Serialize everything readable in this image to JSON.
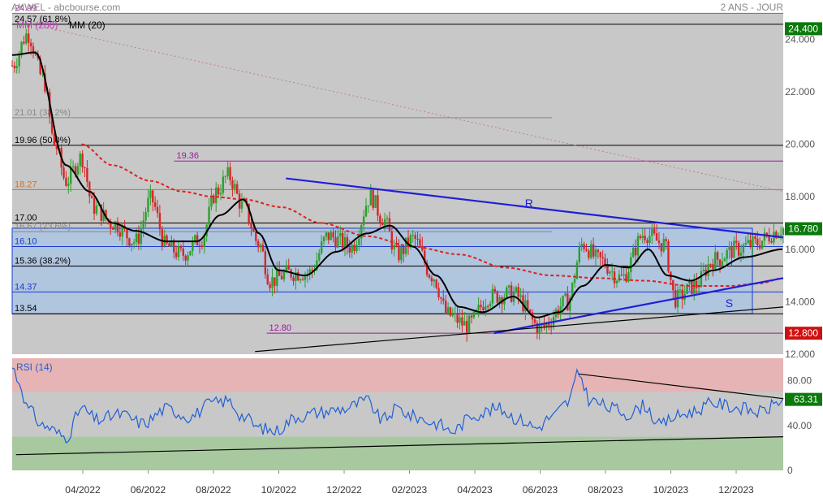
{
  "header": {
    "source": "AKWEL - abcbourse.com",
    "period": "2 ANS - JOUR",
    "legend_ma200": "MM (200)",
    "legend_ma20": "MM (20)"
  },
  "colors": {
    "panel_bg": "#c8c8c8",
    "candle_up": "#2ca02c",
    "candle_down": "#d62728",
    "ma20": "#000000",
    "ma200": "#e02020",
    "trendline": "#1f1fd6",
    "rsi_line": "#1f5fd6",
    "band_fill": "#a8c4e6",
    "rsi_over": "#e6b4b4",
    "rsi_under": "#a8c8a0",
    "axis_label_bg": "#0a7a0a",
    "axis_label_red": "#d01010",
    "fib_line": "#9a1a9a"
  },
  "chart_data": [
    {
      "type": "candlestick",
      "title": "AKWEL",
      "xlabel": "",
      "ylabel": "",
      "ylim": [
        12.0,
        25.0
      ],
      "x_ticks": [
        "04/2022",
        "06/2022",
        "08/2022",
        "10/2022",
        "12/2022",
        "02/2023",
        "04/2023",
        "06/2023",
        "08/2023",
        "10/2023",
        "12/2023"
      ],
      "y_ticks": [
        "12.000",
        "14.000",
        "16.000",
        "18.000",
        "20.000",
        "22.000",
        "24.000"
      ],
      "last_price": "16.780",
      "axis_markers": [
        "24.400",
        "12.800"
      ],
      "price_anchors": [
        {
          "t": 0.0,
          "v": 23.0
        },
        {
          "t": 0.02,
          "v": 24.2
        },
        {
          "t": 0.04,
          "v": 22.5
        },
        {
          "t": 0.055,
          "v": 20.0
        },
        {
          "t": 0.07,
          "v": 18.6
        },
        {
          "t": 0.09,
          "v": 19.5
        },
        {
          "t": 0.105,
          "v": 17.6
        },
        {
          "t": 0.13,
          "v": 17.0
        },
        {
          "t": 0.16,
          "v": 16.3
        },
        {
          "t": 0.18,
          "v": 17.9
        },
        {
          "t": 0.2,
          "v": 16.1
        },
        {
          "t": 0.22,
          "v": 15.8
        },
        {
          "t": 0.245,
          "v": 16.4
        },
        {
          "t": 0.265,
          "v": 18.2
        },
        {
          "t": 0.28,
          "v": 18.8
        },
        {
          "t": 0.3,
          "v": 17.6
        },
        {
          "t": 0.32,
          "v": 16.2
        },
        {
          "t": 0.335,
          "v": 14.8
        },
        {
          "t": 0.36,
          "v": 15.1
        },
        {
          "t": 0.385,
          "v": 15.1
        },
        {
          "t": 0.41,
          "v": 16.5
        },
        {
          "t": 0.44,
          "v": 16.1
        },
        {
          "t": 0.465,
          "v": 18.0
        },
        {
          "t": 0.48,
          "v": 17.2
        },
        {
          "t": 0.5,
          "v": 15.8
        },
        {
          "t": 0.52,
          "v": 16.4
        },
        {
          "t": 0.545,
          "v": 15.0
        },
        {
          "t": 0.565,
          "v": 13.5
        },
        {
          "t": 0.59,
          "v": 13.1
        },
        {
          "t": 0.62,
          "v": 14.2
        },
        {
          "t": 0.65,
          "v": 14.3
        },
        {
          "t": 0.685,
          "v": 13.0
        },
        {
          "t": 0.72,
          "v": 14.0
        },
        {
          "t": 0.74,
          "v": 16.2
        },
        {
          "t": 0.76,
          "v": 15.6
        },
        {
          "t": 0.79,
          "v": 14.9
        },
        {
          "t": 0.82,
          "v": 16.6
        },
        {
          "t": 0.845,
          "v": 16.2
        },
        {
          "t": 0.86,
          "v": 14.1
        },
        {
          "t": 0.885,
          "v": 14.6
        },
        {
          "t": 0.91,
          "v": 15.6
        },
        {
          "t": 0.94,
          "v": 16.0
        },
        {
          "t": 0.96,
          "v": 16.2
        },
        {
          "t": 1.0,
          "v": 16.78
        }
      ],
      "ma20_anchors": [
        {
          "t": 0.0,
          "v": 23.4
        },
        {
          "t": 0.03,
          "v": 23.5
        },
        {
          "t": 0.07,
          "v": 19.2
        },
        {
          "t": 0.1,
          "v": 18.2
        },
        {
          "t": 0.13,
          "v": 17.0
        },
        {
          "t": 0.16,
          "v": 16.7
        },
        {
          "t": 0.2,
          "v": 16.3
        },
        {
          "t": 0.24,
          "v": 16.3
        },
        {
          "t": 0.27,
          "v": 17.3
        },
        {
          "t": 0.3,
          "v": 17.9
        },
        {
          "t": 0.32,
          "v": 16.6
        },
        {
          "t": 0.345,
          "v": 15.2
        },
        {
          "t": 0.38,
          "v": 15.0
        },
        {
          "t": 0.42,
          "v": 15.9
        },
        {
          "t": 0.46,
          "v": 16.6
        },
        {
          "t": 0.49,
          "v": 16.9
        },
        {
          "t": 0.52,
          "v": 16.1
        },
        {
          "t": 0.55,
          "v": 15.0
        },
        {
          "t": 0.58,
          "v": 13.8
        },
        {
          "t": 0.61,
          "v": 13.6
        },
        {
          "t": 0.65,
          "v": 14.2
        },
        {
          "t": 0.68,
          "v": 13.4
        },
        {
          "t": 0.71,
          "v": 13.6
        },
        {
          "t": 0.74,
          "v": 14.6
        },
        {
          "t": 0.77,
          "v": 15.4
        },
        {
          "t": 0.8,
          "v": 15.3
        },
        {
          "t": 0.825,
          "v": 16.0
        },
        {
          "t": 0.85,
          "v": 15.0
        },
        {
          "t": 0.88,
          "v": 14.8
        },
        {
          "t": 0.91,
          "v": 15.2
        },
        {
          "t": 0.95,
          "v": 15.7
        },
        {
          "t": 1.0,
          "v": 16.0
        }
      ],
      "ma200_anchors": [
        {
          "t": 0.09,
          "v": 20.0
        },
        {
          "t": 0.13,
          "v": 19.2
        },
        {
          "t": 0.18,
          "v": 18.6
        },
        {
          "t": 0.22,
          "v": 18.2
        },
        {
          "t": 0.26,
          "v": 18.0
        },
        {
          "t": 0.3,
          "v": 17.9
        },
        {
          "t": 0.35,
          "v": 17.6
        },
        {
          "t": 0.4,
          "v": 17.0
        },
        {
          "t": 0.46,
          "v": 16.5
        },
        {
          "t": 0.52,
          "v": 16.1
        },
        {
          "t": 0.58,
          "v": 15.8
        },
        {
          "t": 0.64,
          "v": 15.3
        },
        {
          "t": 0.7,
          "v": 15.0
        },
        {
          "t": 0.76,
          "v": 14.9
        },
        {
          "t": 0.82,
          "v": 14.8
        },
        {
          "t": 0.88,
          "v": 14.6
        },
        {
          "t": 0.93,
          "v": 14.6
        },
        {
          "t": 0.97,
          "v": 14.7
        },
        {
          "t": 1.0,
          "v": 14.9
        }
      ],
      "levels": [
        {
          "value": 24.99,
          "label": "24.99",
          "color": "#c03ac0"
        },
        {
          "value": 24.57,
          "label": "24.57 (61.8%)",
          "color": "#000000"
        },
        {
          "value": 21.01,
          "label": "21.01 (38.2%)",
          "color": "#888888"
        },
        {
          "value": 19.96,
          "label": "19.96 (50.0%)",
          "color": "#000000"
        },
        {
          "value": 19.36,
          "label": "19.36",
          "color": "#9a1a9a"
        },
        {
          "value": 18.27,
          "label": "18.27",
          "color": "#d07020"
        },
        {
          "value": 17.0,
          "label": "17.00",
          "color": "#000000"
        },
        {
          "value": 16.67,
          "label": "16.67 (23.6%)",
          "color": "#888888"
        },
        {
          "value": 16.1,
          "label": "16.10",
          "color": "#1a3ad0"
        },
        {
          "value": 15.36,
          "label": "15.36 (38.2%)",
          "color": "#000000"
        },
        {
          "value": 14.37,
          "label": "14.37",
          "color": "#1a3ad0"
        },
        {
          "value": 13.54,
          "label": "13.54",
          "color": "#000000"
        },
        {
          "value": 12.8,
          "label": "12.80",
          "color": "#9a1a9a"
        }
      ],
      "annotations": [
        "R",
        "S"
      ]
    },
    {
      "type": "line",
      "title": "RSI (14)",
      "xlabel": "",
      "ylabel": "",
      "ylim": [
        0,
        100
      ],
      "y_ticks": [
        "0",
        "40.00",
        "80.00"
      ],
      "last_value": "63.31",
      "overbought": 70,
      "oversold": 30,
      "rsi_anchors": [
        {
          "t": 0.0,
          "v": 92
        },
        {
          "t": 0.01,
          "v": 78
        },
        {
          "t": 0.02,
          "v": 55
        },
        {
          "t": 0.04,
          "v": 40
        },
        {
          "t": 0.07,
          "v": 30
        },
        {
          "t": 0.09,
          "v": 55
        },
        {
          "t": 0.11,
          "v": 45
        },
        {
          "t": 0.14,
          "v": 50
        },
        {
          "t": 0.17,
          "v": 42
        },
        {
          "t": 0.2,
          "v": 55
        },
        {
          "t": 0.23,
          "v": 48
        },
        {
          "t": 0.26,
          "v": 60
        },
        {
          "t": 0.28,
          "v": 62
        },
        {
          "t": 0.3,
          "v": 48
        },
        {
          "t": 0.32,
          "v": 38
        },
        {
          "t": 0.34,
          "v": 35
        },
        {
          "t": 0.37,
          "v": 48
        },
        {
          "t": 0.4,
          "v": 52
        },
        {
          "t": 0.43,
          "v": 55
        },
        {
          "t": 0.46,
          "v": 62
        },
        {
          "t": 0.48,
          "v": 45
        },
        {
          "t": 0.5,
          "v": 55
        },
        {
          "t": 0.52,
          "v": 48
        },
        {
          "t": 0.55,
          "v": 42
        },
        {
          "t": 0.57,
          "v": 35
        },
        {
          "t": 0.6,
          "v": 50
        },
        {
          "t": 0.63,
          "v": 55
        },
        {
          "t": 0.66,
          "v": 45
        },
        {
          "t": 0.68,
          "v": 38
        },
        {
          "t": 0.7,
          "v": 48
        },
        {
          "t": 0.72,
          "v": 60
        },
        {
          "t": 0.735,
          "v": 86
        },
        {
          "t": 0.75,
          "v": 62
        },
        {
          "t": 0.78,
          "v": 55
        },
        {
          "t": 0.8,
          "v": 50
        },
        {
          "t": 0.82,
          "v": 58
        },
        {
          "t": 0.84,
          "v": 40
        },
        {
          "t": 0.86,
          "v": 48
        },
        {
          "t": 0.88,
          "v": 52
        },
        {
          "t": 0.91,
          "v": 60
        },
        {
          "t": 0.94,
          "v": 56
        },
        {
          "t": 0.97,
          "v": 52
        },
        {
          "t": 1.0,
          "v": 63
        }
      ]
    }
  ]
}
